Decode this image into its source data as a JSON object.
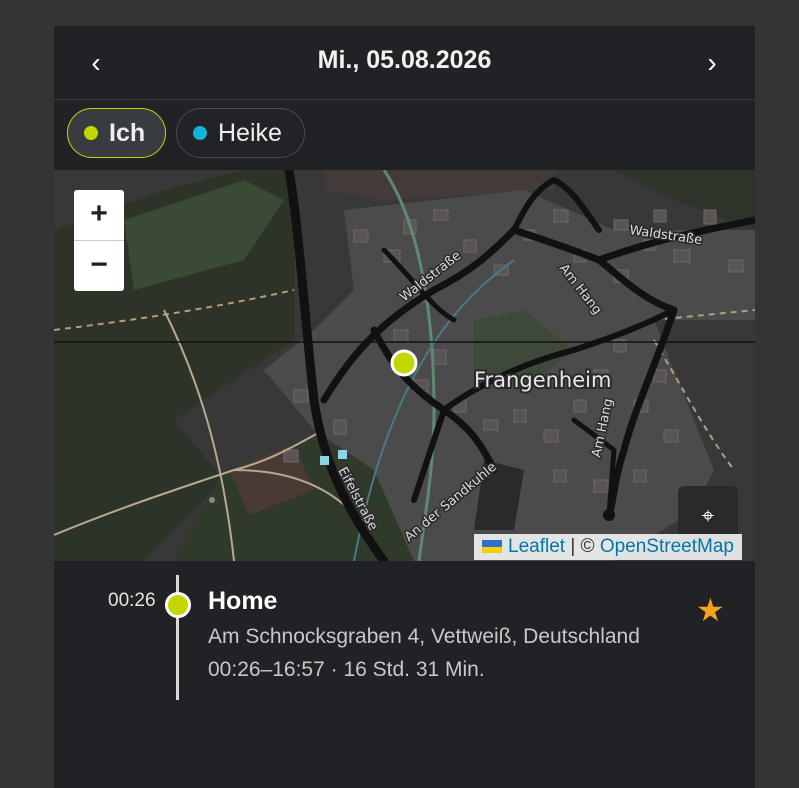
{
  "header": {
    "prev": "‹",
    "next": "›",
    "date": "Mi., 05.08.2026"
  },
  "people": [
    {
      "name": "Ich",
      "color": "#c4d600",
      "active": true
    },
    {
      "name": "Heike",
      "color": "#14b4d8",
      "active": false
    }
  ],
  "map": {
    "zoom_in": "+",
    "zoom_out": "−",
    "locate": "⌖",
    "place_label": "Frangenheim",
    "street_labels": [
      "Waldstraße",
      "Waldstraße",
      "Am Hang",
      "Am Hang",
      "Eifelstraße",
      "An der Sandkuhle"
    ],
    "attribution": {
      "leaflet": "Leaflet",
      "separator": "| ©",
      "osm": "OpenStreetMap"
    },
    "marker_color": "#c4d600"
  },
  "timeline": {
    "time": "00:26",
    "title": "Home",
    "address": "Am Schnocksgraben 4, Vettweiß, Deutschland",
    "duration": "00:26–16:57 · 16 Std. 31 Min.",
    "star": "★"
  }
}
